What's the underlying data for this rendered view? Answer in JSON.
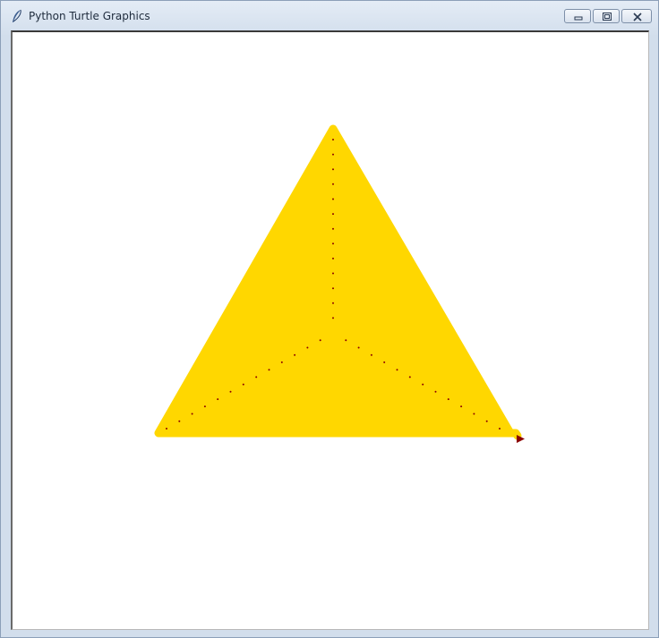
{
  "window": {
    "title": "Python Turtle Graphics",
    "icon": "feather-icon",
    "controls": [
      "minimize-icon",
      "restore-icon",
      "close-icon"
    ]
  },
  "canvas": {
    "background": "#ffffff",
    "fill_color": "#ffd700",
    "trail_color": "#8b0000",
    "turtle_icon": "turtle-arrow-icon"
  }
}
